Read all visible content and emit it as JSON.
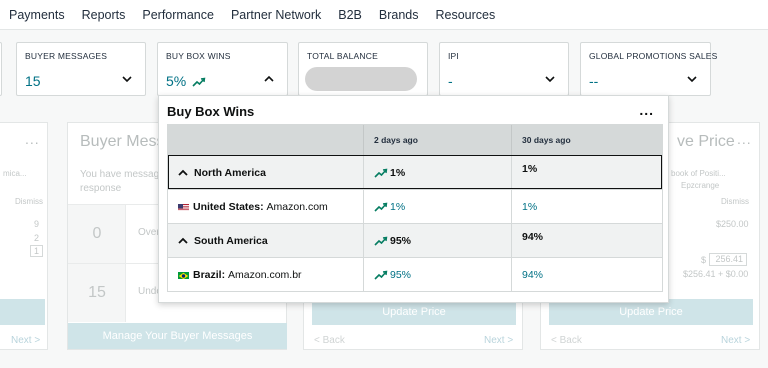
{
  "nav": {
    "items": [
      "Payments",
      "Reports",
      "Performance",
      "Partner Network",
      "B2B",
      "Brands",
      "Resources"
    ]
  },
  "metrics": [
    {
      "label": "BUYER MESSAGES",
      "value": "15",
      "chevron": "chevron-down-icon"
    },
    {
      "label": "BUY BOX WINS",
      "value": "5%",
      "trend": "trend-up-icon",
      "chevron": "chevron-up-icon"
    },
    {
      "label": "TOTAL BALANCE",
      "value_hidden": true,
      "chevron": "chevron-down-icon"
    },
    {
      "label": "IPI",
      "value": "-",
      "chevron": "chevron-down-icon"
    },
    {
      "label": "GLOBAL PROMOTIONS SALES",
      "value": "--",
      "chevron": "chevron-down-icon"
    }
  ],
  "popup": {
    "title": "Buy Box Wins",
    "more": "...",
    "columns": [
      "",
      "2 days ago",
      "30 days ago"
    ],
    "rows": [
      {
        "type": "region",
        "name": "North America",
        "d2": "1%",
        "d30": "1%",
        "selected": true
      },
      {
        "type": "country",
        "flag": "us",
        "country": "United States:",
        "market": "Amazon.com",
        "d2": "1%",
        "d30": "1%"
      },
      {
        "type": "region",
        "name": "South America",
        "d2": "95%",
        "d30": "94%"
      },
      {
        "type": "country",
        "flag": "br",
        "country": "Brazil:",
        "market": "Amazon.com.br",
        "d2": "95%",
        "d30": "94%"
      }
    ]
  },
  "background": {
    "left_widget": {
      "more": "...",
      "small_text": "mica...",
      "col_header": "Dismiss",
      "nums": [
        "9",
        "2",
        "1"
      ],
      "next": "Next >"
    },
    "buyer_messages": {
      "title": "Buyer Mess",
      "desc_line1": "You have messag",
      "desc_line2": "response",
      "rows": [
        {
          "num": "0",
          "text": "Over"
        },
        {
          "num": "15",
          "text": "Unde"
        }
      ],
      "button": "Manage Your Buyer Messages"
    },
    "middle_widget": {
      "button": "Update Price",
      "back": "< Back",
      "next": "Next >"
    },
    "price_widget": {
      "title": "ve Price",
      "small1": "book of Positi...",
      "small2": "Epzcrange",
      "col_header": "Dismiss",
      "price": "$250.00",
      "input_prefix": "$",
      "input_value": "256.41",
      "calc": "$256.41 + $0.00",
      "button": "Update Price",
      "back": "< Back",
      "next": "Next >"
    }
  }
}
